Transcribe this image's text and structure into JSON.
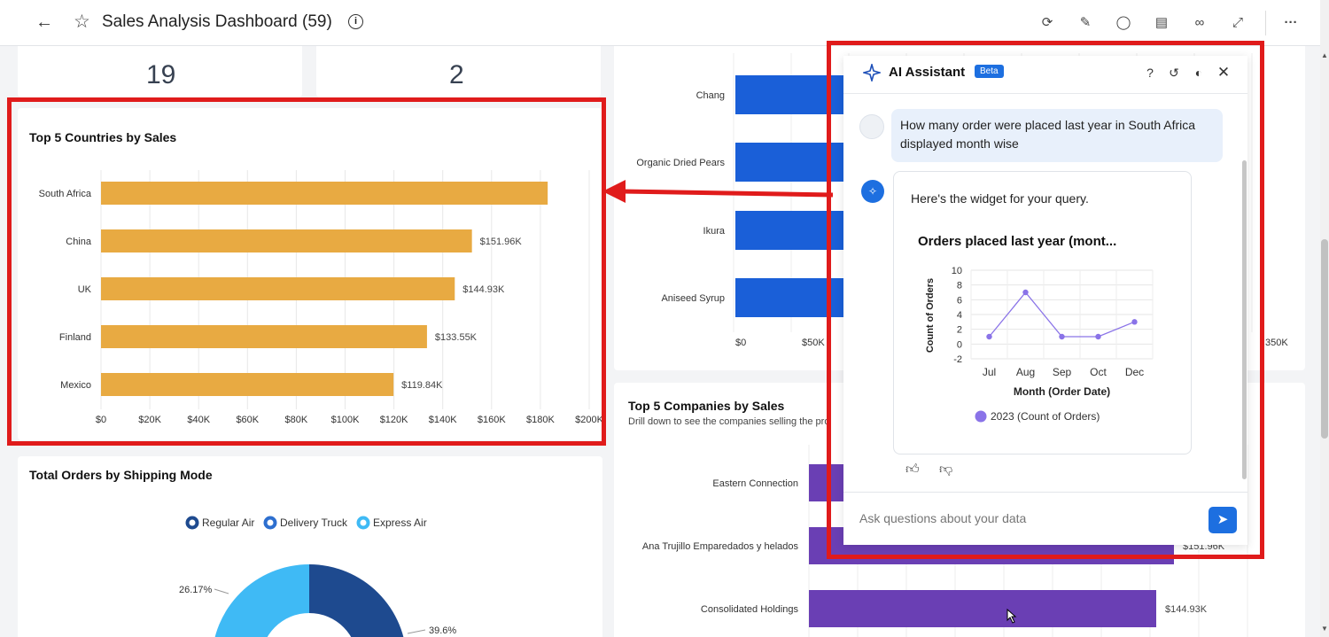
{
  "header": {
    "title": "Sales Analysis Dashboard (59)",
    "icons": [
      "back-arrow-icon",
      "star-icon",
      "info-icon",
      "refresh-icon",
      "edit-icon",
      "comment-icon",
      "schedule-icon",
      "view-icon",
      "expand-icon",
      "more-icon"
    ]
  },
  "kpis": [
    {
      "value": "19"
    },
    {
      "value": "2"
    }
  ],
  "countries_chart": {
    "title": "Top 5 Countries by Sales",
    "categories": [
      "South Africa",
      "China",
      "UK",
      "Finland",
      "Mexico"
    ],
    "values": [
      183,
      151.96,
      144.93,
      133.55,
      119.84
    ],
    "value_labels": [
      "",
      "$151.96K",
      "$144.93K",
      "$133.55K",
      "$119.84K"
    ],
    "x_ticks": [
      "$0",
      "$20K",
      "$40K",
      "$60K",
      "$80K",
      "$100K",
      "$120K",
      "$140K",
      "$160K",
      "$180K",
      "$200K"
    ],
    "bar_color": "#e8aa42"
  },
  "products_chart": {
    "categories": [
      "Chang",
      "Organic Dried Pears",
      "Ikura",
      "Aniseed Syrup"
    ],
    "x_ticks": [
      "$0",
      "$50K",
      "350K"
    ],
    "bar_color": "#1a5fd8"
  },
  "companies_chart": {
    "title": "Top 5 Companies by Sales",
    "subtitle": "Drill down to see the companies selling the pro",
    "categories": [
      "Eastern Connection",
      "Ana Trujillo Emparedados y helados",
      "Consolidated Holdings"
    ],
    "value_labels": [
      "",
      "$151.96K",
      "$144.93K"
    ],
    "bar_color": "#6a3fb4"
  },
  "shipping_chart": {
    "title": "Total Orders by Shipping Mode",
    "legend": [
      "Regular Air",
      "Delivery Truck",
      "Express Air"
    ],
    "legend_colors": [
      "#1e4a8f",
      "#2d6fcf",
      "#3fbaf5"
    ],
    "labels": [
      "26.17%",
      "39.6%"
    ]
  },
  "assistant": {
    "title": "AI Assistant",
    "badge": "Beta",
    "user_message": "How many order were placed last year in South Africa displayed month wise",
    "bot_message": "Here's the widget for your query.",
    "input_placeholder": "Ask questions about your data",
    "icons": [
      "help-icon",
      "reset-icon",
      "theme-icon",
      "close-icon",
      "thumbs-up-icon",
      "thumbs-down-icon",
      "send-icon"
    ]
  },
  "chart_data": {
    "type": "line",
    "title": "Orders placed last year (mont...",
    "x": [
      "Jul",
      "Aug",
      "Sep",
      "Oct",
      "Dec"
    ],
    "series": [
      {
        "name": "2023 (Count of Orders)",
        "values": [
          1,
          7,
          1,
          1,
          3
        ]
      }
    ],
    "xlabel": "Month (Order Date)",
    "ylabel": "Count of Orders",
    "ylim": [
      -2,
      10
    ],
    "y_ticks": [
      "10",
      "8",
      "6",
      "4",
      "2",
      "0",
      "-2"
    ],
    "color": "#8a73e8",
    "grid": true,
    "legend": "bottom"
  }
}
